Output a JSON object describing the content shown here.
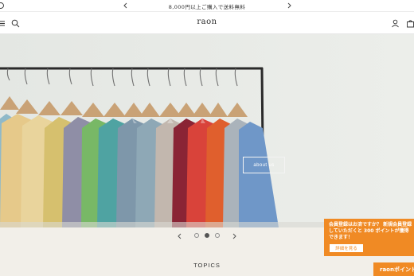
{
  "announcement": {
    "text": "8,000円以上ご購入で送料無料"
  },
  "header": {
    "logo": "raon"
  },
  "hero": {
    "button_label": "about us",
    "slides": {
      "count": 3,
      "active_index": 1
    }
  },
  "topics": {
    "title": "TOPICS"
  },
  "member_popup": {
    "message": "会員登録はお済ですか？ 新規会員登録していただくと 300 ポイントが獲得できます！",
    "button_label": "詳細を見る"
  },
  "points_tab": {
    "label": "raonポイント"
  },
  "colors": {
    "accent": "#f08a24",
    "hero_wall": "#e7eae6",
    "section_bg": "#f2efe9"
  },
  "icons": [
    "menu-icon",
    "search-icon",
    "account-icon",
    "cart-icon",
    "chevron-left-icon",
    "chevron-right-icon"
  ]
}
